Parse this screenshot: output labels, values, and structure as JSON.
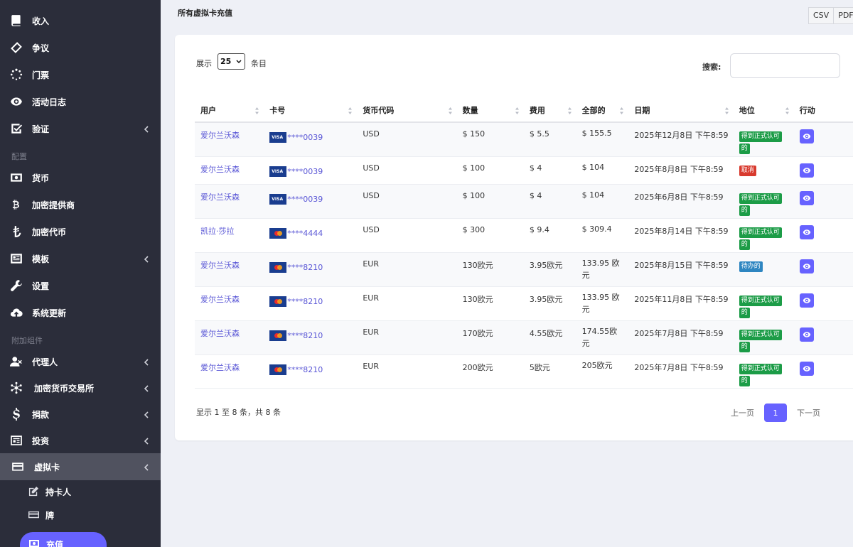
{
  "sidebar": {
    "items": [
      {
        "label": "收入",
        "icon": "book-icon"
      },
      {
        "label": "争议",
        "icon": "ticket-icon"
      },
      {
        "label": "门票",
        "icon": "spinner-icon"
      },
      {
        "label": "活动日志",
        "icon": "eye-icon"
      },
      {
        "label": "验证",
        "icon": "check-square-icon"
      },
      {
        "label": "货币",
        "icon": "money-bill-icon"
      },
      {
        "label": "加密提供商",
        "icon": "bitcoin-icon"
      },
      {
        "label": "加密代币",
        "icon": "lira-icon"
      },
      {
        "label": "模板",
        "icon": "template-icon"
      },
      {
        "label": "设置",
        "icon": "wrench-icon"
      },
      {
        "label": "系统更新",
        "icon": "cloud-upload-icon"
      },
      {
        "label": "代理人",
        "icon": "user-times-icon"
      },
      {
        "label": "加密货币交易所",
        "icon": "network-icon"
      },
      {
        "label": "捐款",
        "icon": "dollar-icon"
      },
      {
        "label": "投资",
        "icon": "invest-icon"
      },
      {
        "label": "虚拟卡",
        "icon": "credit-card-icon"
      }
    ],
    "sections": {
      "config": "配置",
      "addons": "附加组件"
    },
    "sub_items": [
      {
        "label": "持卡人",
        "icon": "edit-icon"
      },
      {
        "label": "牌",
        "icon": "card-icon"
      },
      {
        "label": "充值",
        "icon": "money-icon"
      }
    ]
  },
  "header": {
    "title": "所有虚拟卡充值"
  },
  "export": {
    "csv": "CSV",
    "pdf": "PDF"
  },
  "controls": {
    "show_label": "展示",
    "show_value": "25",
    "entries_label": "条目",
    "search_label": "搜索:",
    "search_value": ""
  },
  "table": {
    "columns": [
      "用户",
      "卡号",
      "货币代码",
      "数量",
      "费用",
      "全部的",
      "日期",
      "地位",
      "行动"
    ],
    "rows": [
      {
        "user": "爱尔兰沃森",
        "brand": "visa",
        "brand_label": "VISA",
        "card": "****0039",
        "currency": "USD",
        "amount": "$ 150",
        "fee": "$ 5.5",
        "total": "$ 155.5",
        "date": "2025年12月8日 下午8:59",
        "status": [
          "得到正式认可",
          "的"
        ],
        "status_color": "#1c9c47"
      },
      {
        "user": "爱尔兰沃森",
        "brand": "visa",
        "brand_label": "VISA",
        "card": "****0039",
        "currency": "USD",
        "amount": "$ 100",
        "fee": "$ 4",
        "total": "$ 104",
        "date": "2025年8月8日 下午8:59",
        "status": [
          "取消"
        ],
        "status_color": "#d83a2e"
      },
      {
        "user": "爱尔兰沃森",
        "brand": "visa",
        "brand_label": "VISA",
        "card": "****0039",
        "currency": "USD",
        "amount": "$ 100",
        "fee": "$ 4",
        "total": "$ 104",
        "date": "2025年6月8日 下午8:59",
        "status": [
          "得到正式认可",
          "的"
        ],
        "status_color": "#1c9c47"
      },
      {
        "user": "凯拉·莎拉",
        "brand": "mastercard",
        "brand_label": "",
        "card": "****4444",
        "currency": "USD",
        "amount": "$ 300",
        "fee": "$ 9.4",
        "total": "$ 309.4",
        "date": "2025年8月14日 下午8:59",
        "status": [
          "得到正式认可",
          "的"
        ],
        "status_color": "#1c9c47"
      },
      {
        "user": "爱尔兰沃森",
        "brand": "mastercard",
        "brand_label": "",
        "card": "****8210",
        "currency": "EUR",
        "amount": "130欧元",
        "fee": "3.95欧元",
        "total": "133.95 欧元",
        "date": "2025年8月15日 下午8:59",
        "status": [
          "待办的"
        ],
        "status_color": "#2e86c1"
      },
      {
        "user": "爱尔兰沃森",
        "brand": "mastercard",
        "brand_label": "",
        "card": "****8210",
        "currency": "EUR",
        "amount": "130欧元",
        "fee": "3.95欧元",
        "total": "133.95 欧元",
        "date": "2025年11月8日 下午8:59",
        "status": [
          "得到正式认可",
          "的"
        ],
        "status_color": "#1c9c47"
      },
      {
        "user": "爱尔兰沃森",
        "brand": "mastercard",
        "brand_label": "",
        "card": "****8210",
        "currency": "EUR",
        "amount": "170欧元",
        "fee": "4.55欧元",
        "total": "174.55欧元",
        "date": "2025年7月8日 下午8:59",
        "status": [
          "得到正式认可",
          "的"
        ],
        "status_color": "#1c9c47"
      },
      {
        "user": "爱尔兰沃森",
        "brand": "mastercard",
        "brand_label": "",
        "card": "****8210",
        "currency": "EUR",
        "amount": "200欧元",
        "fee": "5欧元",
        "total": "205欧元",
        "date": "2025年7月8日 下午8:59",
        "status": [
          "得到正式认可",
          "的"
        ],
        "status_color": "#1c9c47"
      }
    ]
  },
  "footer": {
    "info": "显示 1 至 8 条，共 8 条",
    "prev": "上一页",
    "current_page": "1",
    "next": "下一页"
  },
  "colors": {
    "accent": "#6762ff",
    "sidebar_bg": "#2b2d3a",
    "link": "#5a57d6"
  }
}
